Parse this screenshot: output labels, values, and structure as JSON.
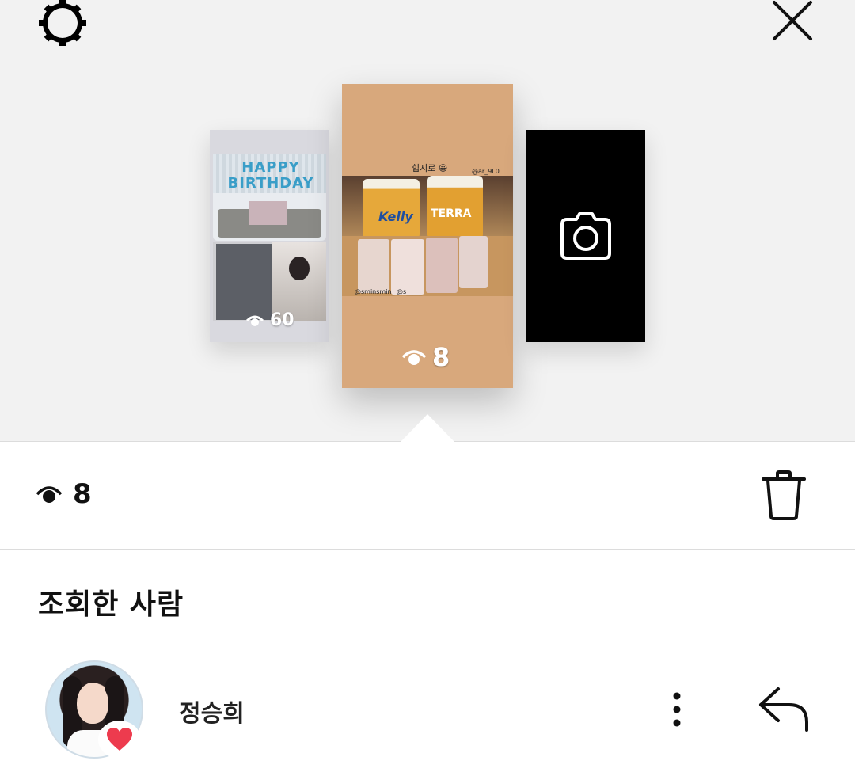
{
  "header": {
    "settings_icon": "settings-gear-icon",
    "close_icon": "close-icon"
  },
  "stories": [
    {
      "position": "left",
      "view_count": "60",
      "banner_text": "HAPPY BIRTHDAY"
    },
    {
      "position": "center",
      "view_count": "8",
      "caption_top": "힙지로 😀",
      "tag_top": "@ar_9L0",
      "beer_label_left": "Kelly",
      "beer_label_right": "TERRA",
      "tag_bottom": "@sminsmin_ @s_____"
    },
    {
      "position": "right",
      "camera_icon": "camera-icon"
    }
  ],
  "stats": {
    "view_count": "8",
    "eye_icon": "eye-icon",
    "trash_icon": "trash-icon"
  },
  "viewers_section": {
    "title": "조회한 사람",
    "viewers": [
      {
        "name": "정승희",
        "liked": true,
        "heart_color": "#ed3b4e"
      }
    ]
  },
  "colors": {
    "top_background": "#f2f2f2",
    "center_story_bg": "#d8a87c",
    "heart": "#ed3b4e"
  }
}
